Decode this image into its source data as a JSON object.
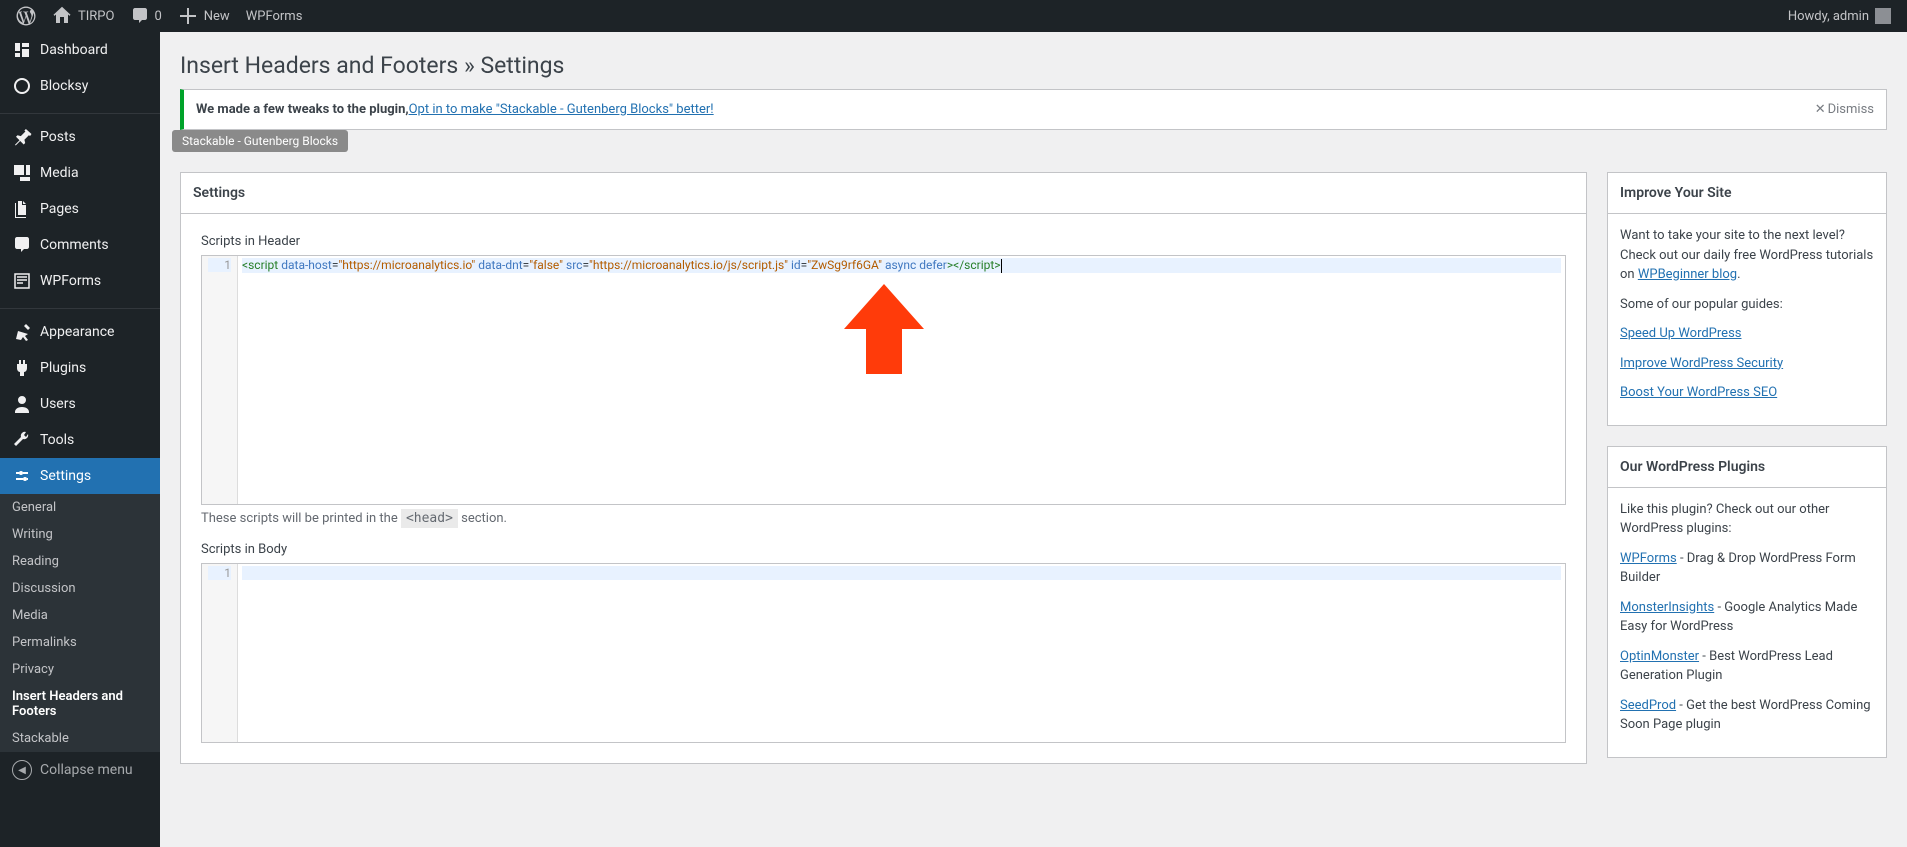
{
  "adminBar": {
    "siteName": "TIRPO",
    "commentCount": "0",
    "newLabel": "New",
    "wpformsLabel": "WPForms",
    "howdy": "Howdy, admin"
  },
  "sidebar": [
    {
      "id": "dashboard",
      "label": "Dashboard",
      "icon": "dashboard"
    },
    {
      "id": "blocksy",
      "label": "Blocksy",
      "icon": "blocksy"
    },
    {
      "sep": true
    },
    {
      "id": "posts",
      "label": "Posts",
      "icon": "pin"
    },
    {
      "id": "media",
      "label": "Media",
      "icon": "media"
    },
    {
      "id": "pages",
      "label": "Pages",
      "icon": "pages"
    },
    {
      "id": "comments",
      "label": "Comments",
      "icon": "comment"
    },
    {
      "id": "wpforms",
      "label": "WPForms",
      "icon": "wpforms"
    },
    {
      "sep": true
    },
    {
      "id": "appearance",
      "label": "Appearance",
      "icon": "appearance"
    },
    {
      "id": "plugins",
      "label": "Plugins",
      "icon": "plugin"
    },
    {
      "id": "users",
      "label": "Users",
      "icon": "user"
    },
    {
      "id": "tools",
      "label": "Tools",
      "icon": "tools"
    },
    {
      "id": "settings",
      "label": "Settings",
      "icon": "settings",
      "active": true
    }
  ],
  "submenu": [
    {
      "label": "General"
    },
    {
      "label": "Writing"
    },
    {
      "label": "Reading"
    },
    {
      "label": "Discussion"
    },
    {
      "label": "Media"
    },
    {
      "label": "Permalinks"
    },
    {
      "label": "Privacy"
    },
    {
      "label": "Insert Headers and Footers",
      "current": true
    },
    {
      "label": "Stackable"
    }
  ],
  "collapseLabel": "Collapse menu",
  "pageTitle": "Insert Headers and Footers » Settings",
  "notice": {
    "text": "We made a few tweaks to the plugin, ",
    "link": "Opt in to make \"Stackable - Gutenberg Blocks\" better!",
    "dismiss": "Dismiss",
    "tag": "Stackable - Gutenberg Blocks"
  },
  "settingsBox": {
    "title": "Settings",
    "headerLabel": "Scripts in Header",
    "headerCode": "<script data-host=\"https://microanalytics.io\" data-dnt=\"false\" src=\"https://microanalytics.io/js/script.js\" id=\"ZwSg9rf6GA\" async defer></script>",
    "headerHelpPrefix": "These scripts will be printed in the ",
    "headerHelpCode": "<head>",
    "headerHelpSuffix": " section.",
    "bodyLabel": "Scripts in Body"
  },
  "improveBox": {
    "title": "Improve Your Site",
    "intro": "Want to take your site to the next level? Check out our daily free WordPress tutorials on ",
    "introLink": "WPBeginner blog",
    "popular": "Some of our popular guides:",
    "links": [
      "Speed Up WordPress",
      "Improve WordPress Security",
      "Boost Your WordPress SEO"
    ]
  },
  "pluginsBox": {
    "title": "Our WordPress Plugins",
    "intro": "Like this plugin? Check out our other WordPress plugins:",
    "items": [
      {
        "name": "WPForms",
        "desc": " - Drag & Drop WordPress Form Builder"
      },
      {
        "name": "MonsterInsights",
        "desc": " - Google Analytics Made Easy for WordPress"
      },
      {
        "name": "OptinMonster",
        "desc": " - Best WordPress Lead Generation Plugin"
      },
      {
        "name": "SeedProd",
        "desc": " - Get the best WordPress Coming Soon Page plugin"
      }
    ]
  }
}
